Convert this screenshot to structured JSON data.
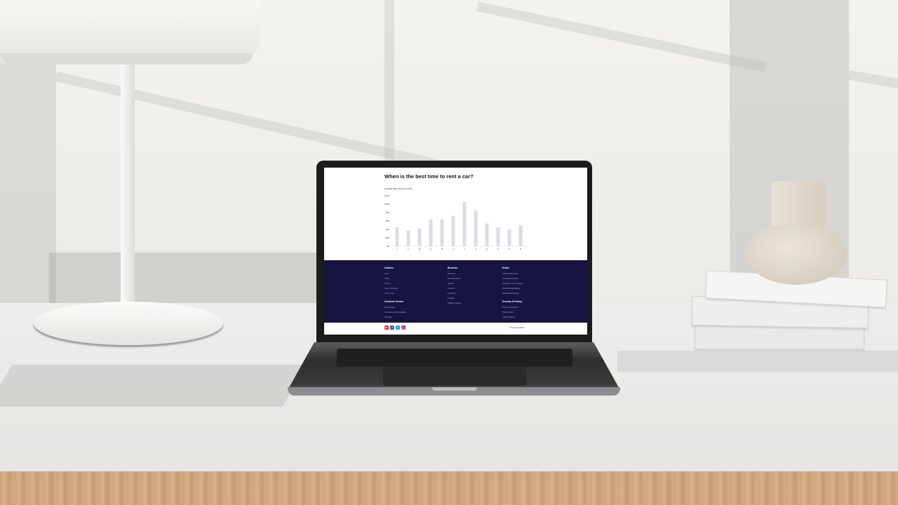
{
  "page": {
    "title": "When is the best time to rent a car?"
  },
  "chart_data": {
    "type": "bar",
    "title": "Average daily price per month",
    "ylim": [
      0,
      120
    ],
    "yticks": [
      "$0",
      "$20",
      "$40",
      "$60",
      "$80",
      "$100",
      "$120"
    ],
    "categories": [
      "J",
      "F",
      "M",
      "A",
      "M",
      "J",
      "J",
      "A",
      "S",
      "O",
      "N",
      "D"
    ],
    "values": [
      45,
      37,
      42,
      64,
      64,
      72,
      105,
      85,
      54,
      45,
      40,
      50
    ],
    "bar_color": "#dcdce6",
    "grid": false
  },
  "footer": {
    "bg_color": "#171442",
    "vehicles": {
      "heading": "Vehicles",
      "links": [
        "Cars",
        "SUVs",
        "Trucks",
        "Vans & Minivans",
        "Luxury Cars"
      ]
    },
    "customer_service": {
      "heading": "Customer Service",
      "links": [
        "Help & FAQs",
        "Customers with Disabilities",
        "Site Map"
      ]
    },
    "business": {
      "heading": "Business",
      "links": [
        "About Us",
        "How Car Rental",
        "Careers",
        "Investors",
        "Franchise",
        "Contact",
        "Affiliate Program"
      ]
    },
    "extras": {
      "heading": "Extras",
      "links": [
        "Additional Products",
        "Car Rental Services",
        "Protections & Coverages",
        "Road Damage Waiver",
        "Roadside Assistance"
      ]
    },
    "security": {
      "heading": "Security & Privacy",
      "links": [
        "Terms & Conditions",
        "Privacy Policy",
        "Cookie Settings"
      ]
    }
  },
  "bottom": {
    "copyright": "© Enterprise 2023",
    "social_icons": [
      "youtube-icon",
      "facebook-icon",
      "twitter-icon",
      "instagram-icon"
    ]
  }
}
